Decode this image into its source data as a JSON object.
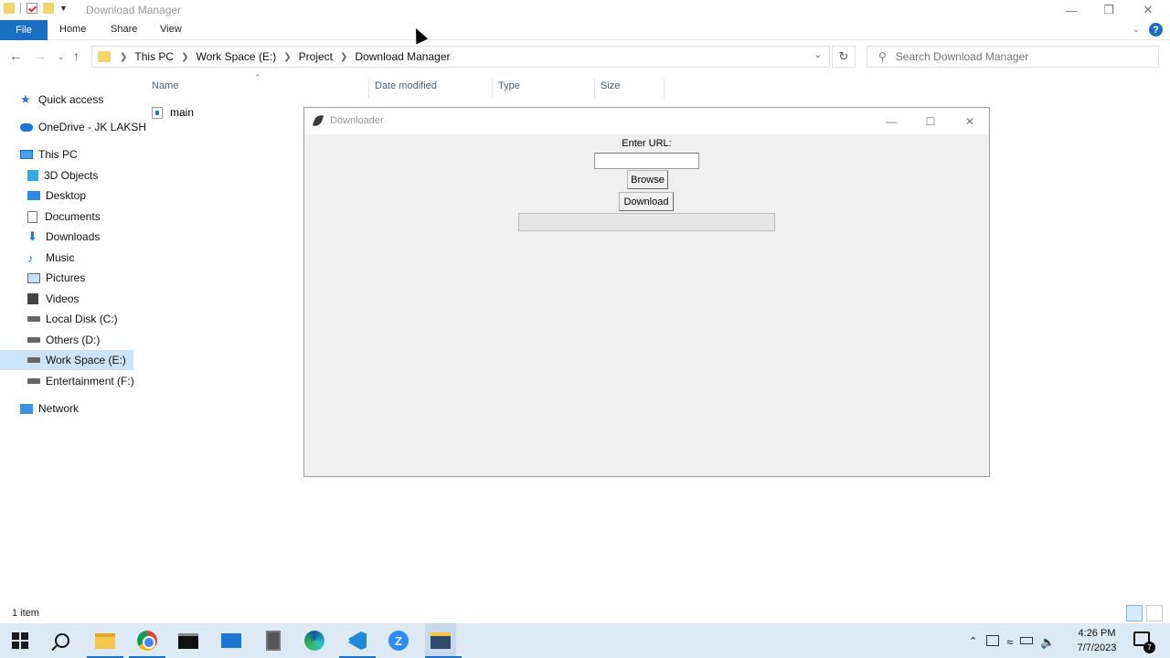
{
  "window": {
    "title": "Download Manager",
    "minimize_icon": "minimize-icon",
    "restore_icon": "restore-icon",
    "close_icon": "close-icon"
  },
  "ribbon": {
    "tabs": [
      {
        "label": "File"
      },
      {
        "label": "Home"
      },
      {
        "label": "Share"
      },
      {
        "label": "View"
      }
    ],
    "help_label": "?"
  },
  "address": {
    "crumbs": [
      "This PC",
      "Work Space (E:)",
      "Project",
      "Download Manager"
    ]
  },
  "search": {
    "placeholder": "Search Download Manager"
  },
  "navpane": {
    "items": [
      {
        "label": "Quick access",
        "icon": "star-icon"
      },
      {
        "label": "OneDrive - JK LAKSH",
        "icon": "cloud-icon"
      },
      {
        "label": "This PC",
        "icon": "computer-icon"
      },
      {
        "label": "3D Objects",
        "icon": "cube-icon"
      },
      {
        "label": "Desktop",
        "icon": "desktop-icon"
      },
      {
        "label": "Documents",
        "icon": "document-icon"
      },
      {
        "label": "Downloads",
        "icon": "download-arrow-icon"
      },
      {
        "label": "Music",
        "icon": "music-note-icon"
      },
      {
        "label": "Pictures",
        "icon": "picture-icon"
      },
      {
        "label": "Videos",
        "icon": "film-icon"
      },
      {
        "label": "Local Disk (C:)",
        "icon": "drive-icon"
      },
      {
        "label": "Others (D:)",
        "icon": "drive-icon"
      },
      {
        "label": "Work Space (E:)",
        "icon": "drive-icon",
        "selected": true
      },
      {
        "label": "Entertainment (F:)",
        "icon": "drive-icon"
      },
      {
        "label": "Network",
        "icon": "network-icon"
      }
    ]
  },
  "filelist": {
    "columns": [
      "Name",
      "Date modified",
      "Type",
      "Size"
    ],
    "rows": [
      {
        "name": "main",
        "icon": "python-file-icon"
      }
    ]
  },
  "status": {
    "count": "1 item"
  },
  "downloader": {
    "title": "Downloader",
    "url_label": "Enter URL:",
    "url_value": "",
    "browse_label": "Browse",
    "download_label": "Download",
    "progress_fraction": 0
  },
  "taskbar": {
    "time": "4:26 PM",
    "date": "7/7/2023",
    "notification_count": "7",
    "zoom_letter": "Z"
  },
  "colors": {
    "accent": "#1a6fc4",
    "selection": "#cce4f7",
    "taskbar": "#dde9f5"
  }
}
